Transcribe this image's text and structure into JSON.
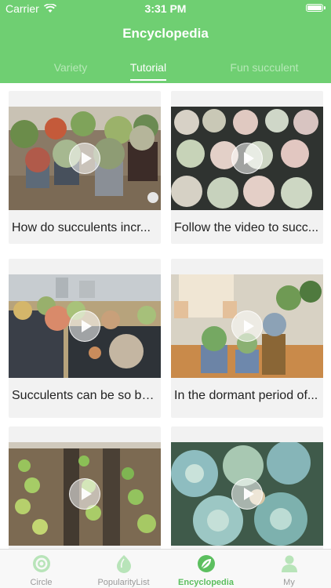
{
  "status_bar": {
    "carrier": "Carrier",
    "time": "3:31 PM"
  },
  "header": {
    "title": "Encyclopedia"
  },
  "tabs": [
    {
      "label": "Variety"
    },
    {
      "label": "Tutorial"
    },
    {
      "label": "Fun succulent"
    }
  ],
  "selected_tab": "Tutorial",
  "videos": [
    {
      "title": "How do succulents incr..."
    },
    {
      "title": "Follow the video to succ..."
    },
    {
      "title": "Succulents can be so be..."
    },
    {
      "title": "In the dormant period of..."
    },
    {
      "title": ""
    },
    {
      "title": ""
    }
  ],
  "bottom_nav": [
    {
      "label": "Circle",
      "icon": "circle-icon"
    },
    {
      "label": "PopularityList",
      "icon": "leaf-drop-icon"
    },
    {
      "label": "Encyclopedia",
      "icon": "leaf-icon"
    },
    {
      "label": "My",
      "icon": "person-icon"
    }
  ],
  "selected_nav": "Encyclopedia",
  "colors": {
    "brand_green": "#6fcf72",
    "inactive_tab": "#b6e8b7",
    "nav_active": "#5cbf5f",
    "nav_inactive": "#9a9a9a"
  }
}
